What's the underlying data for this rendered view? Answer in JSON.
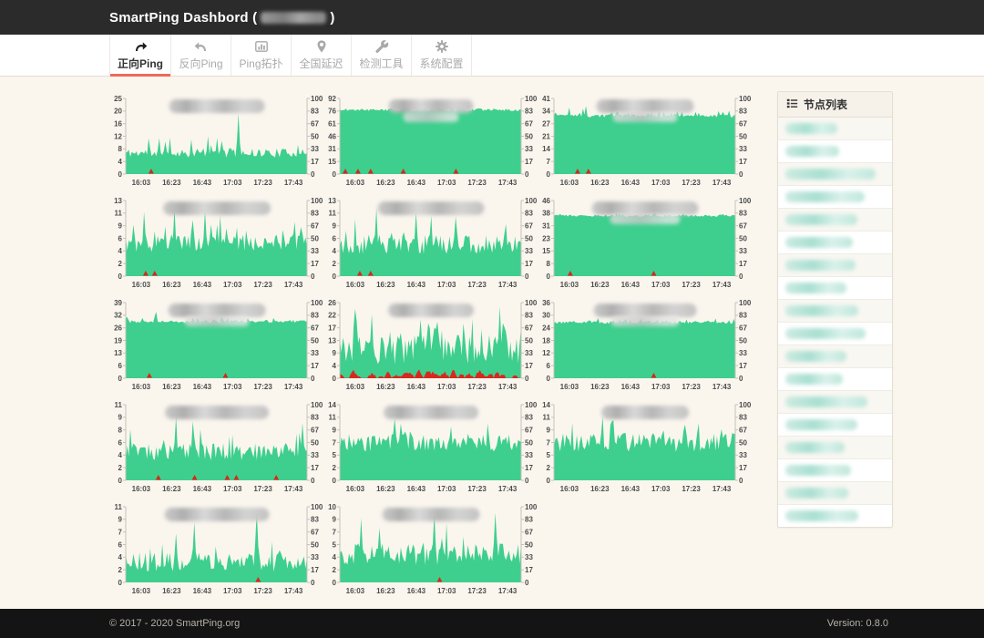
{
  "header": {
    "title_prefix": "SmartPing Dashbord (",
    "title_suffix": ")",
    "host_redacted": true
  },
  "nav": {
    "tabs": [
      {
        "label": "正向Ping",
        "icon": "forward-arrow-icon",
        "active": true
      },
      {
        "label": "反向Ping",
        "icon": "back-arrow-icon",
        "active": false
      },
      {
        "label": "Ping拓扑",
        "icon": "bar-chart-icon",
        "active": false
      },
      {
        "label": "全国延迟",
        "icon": "map-pin-icon",
        "active": false
      },
      {
        "label": "检测工具",
        "icon": "wrench-icon",
        "active": false
      },
      {
        "label": "系统配置",
        "icon": "gear-icon",
        "active": false
      }
    ]
  },
  "sidebar": {
    "title": "节点列表",
    "icon": "list-icon",
    "node_count": 18,
    "nodes_redacted": true
  },
  "footer": {
    "copyright": "© 2017 - 2020 SmartPing.org",
    "version": "Version: 0.8.0"
  },
  "colors": {
    "accent_green": "#3ecf8e",
    "loss_red": "#d7281d",
    "active_tab_underline": "#f0695a",
    "header_bg": "#2b2b2b",
    "page_bg": "#faf6ee"
  },
  "chart_data": {
    "type": "area",
    "note": "14 ping latency area charts; titles blurred in source; green=latency ms (left axis), right axis=availability %, red=packet loss",
    "x_ticks": [
      "16:03",
      "16:23",
      "16:43",
      "17:03",
      "17:23",
      "17:43"
    ],
    "right_ticks": [
      0,
      17,
      33,
      50,
      67,
      83,
      100
    ],
    "charts": [
      {
        "title_redacted": true,
        "left_ticks": [
          0,
          4,
          8,
          12,
          16,
          20,
          25
        ],
        "profile": {
          "base": 0.28,
          "noise": 0.06,
          "spike_prob": 0.08,
          "spike": 0.3,
          "peaks": [
            {
              "x": 0.62,
              "v": 0.8
            },
            {
              "x": 0.45,
              "v": 0.5
            },
            {
              "x": 0.5,
              "v": 0.48
            }
          ]
        },
        "loss_area": false,
        "loss_marks": [
          0.14
        ],
        "seed": 11
      },
      {
        "title_redacted": true,
        "left_ticks": [
          0,
          15,
          31,
          46,
          61,
          76,
          92
        ],
        "profile": {
          "base": 0.85,
          "noise": 0.018,
          "spike_prob": 0.05,
          "spike": 0.05
        },
        "loss_area": false,
        "loss_marks": [
          0.03,
          0.1,
          0.17,
          0.35,
          0.64
        ],
        "seed": 22
      },
      {
        "title_redacted": true,
        "left_ticks": [
          0,
          7,
          14,
          21,
          27,
          34,
          41
        ],
        "profile": {
          "base": 0.77,
          "noise": 0.02,
          "spike_prob": 0.18,
          "spike": 0.09,
          "peaks": [
            {
              "x": 0.08,
              "v": 0.88
            },
            {
              "x": 0.18,
              "v": 0.9
            }
          ]
        },
        "loss_area": false,
        "loss_marks": [
          0.13,
          0.19
        ],
        "seed": 33
      },
      {
        "title_redacted": true,
        "left_ticks": [
          0,
          2,
          4,
          6,
          9,
          11,
          13
        ],
        "profile": {
          "base": 0.44,
          "noise": 0.12,
          "spike_prob": 0.12,
          "spike": 0.3,
          "peaks": [
            {
              "x": 0.1,
              "v": 0.85
            },
            {
              "x": 0.27,
              "v": 0.9
            },
            {
              "x": 0.44,
              "v": 0.88
            },
            {
              "x": 0.52,
              "v": 0.8
            }
          ]
        },
        "loss_area": false,
        "loss_marks": [
          0.11,
          0.16
        ],
        "seed": 44
      },
      {
        "title_redacted": true,
        "left_ticks": [
          0,
          2,
          4,
          6,
          9,
          11,
          13
        ],
        "profile": {
          "base": 0.42,
          "noise": 0.13,
          "spike_prob": 0.12,
          "spike": 0.3,
          "peaks": [
            {
              "x": 0.2,
              "v": 0.9
            },
            {
              "x": 0.42,
              "v": 0.85
            },
            {
              "x": 0.5,
              "v": 0.8
            }
          ]
        },
        "loss_area": false,
        "loss_marks": [
          0.11,
          0.17
        ],
        "seed": 55
      },
      {
        "title_redacted": true,
        "left_ticks": [
          0,
          8,
          15,
          23,
          31,
          38,
          46
        ],
        "profile": {
          "base": 0.8,
          "noise": 0.015,
          "spike_prob": 0.08,
          "spike": 0.04
        },
        "loss_area": false,
        "loss_marks": [
          0.09,
          0.55
        ],
        "seed": 66
      },
      {
        "title_redacted": true,
        "left_ticks": [
          0,
          6,
          13,
          19,
          26,
          32,
          39
        ],
        "profile": {
          "base": 0.75,
          "noise": 0.02,
          "spike_prob": 0.15,
          "spike": 0.07,
          "peaks": [
            {
              "x": 0.17,
              "v": 0.88
            }
          ]
        },
        "loss_area": false,
        "loss_marks": [
          0.13,
          0.55
        ],
        "seed": 77
      },
      {
        "title_redacted": true,
        "left_ticks": [
          0,
          4,
          9,
          13,
          17,
          22,
          26
        ],
        "profile": {
          "base": 0.38,
          "noise": 0.2,
          "spike_prob": 0.25,
          "spike": 0.4,
          "peaks": [
            {
              "x": 0.88,
              "v": 0.95
            },
            {
              "x": 0.18,
              "v": 0.85
            }
          ]
        },
        "loss_area": true,
        "loss_marks": [],
        "seed": 88
      },
      {
        "title_redacted": true,
        "left_ticks": [
          0,
          6,
          12,
          18,
          24,
          30,
          36
        ],
        "profile": {
          "base": 0.74,
          "noise": 0.02,
          "spike_prob": 0.15,
          "spike": 0.06
        },
        "loss_area": false,
        "loss_marks": [
          0.55
        ],
        "seed": 99
      },
      {
        "title_redacted": true,
        "left_ticks": [
          0,
          2,
          4,
          6,
          8,
          9,
          11
        ],
        "profile": {
          "base": 0.38,
          "noise": 0.12,
          "spike_prob": 0.12,
          "spike": 0.3,
          "peaks": [
            {
              "x": 0.28,
              "v": 0.85
            },
            {
              "x": 0.37,
              "v": 0.78
            }
          ]
        },
        "loss_area": false,
        "loss_marks": [
          0.18,
          0.38,
          0.56,
          0.61,
          0.83
        ],
        "seed": 110
      },
      {
        "title_redacted": true,
        "left_ticks": [
          0,
          2,
          5,
          7,
          9,
          11,
          14
        ],
        "profile": {
          "base": 0.5,
          "noise": 0.12,
          "spike_prob": 0.12,
          "spike": 0.25,
          "peaks": [
            {
              "x": 0.3,
              "v": 0.82
            },
            {
              "x": 0.34,
              "v": 0.75
            }
          ]
        },
        "loss_area": false,
        "loss_marks": [],
        "seed": 121
      },
      {
        "title_redacted": true,
        "left_ticks": [
          0,
          2,
          5,
          7,
          9,
          11,
          14
        ],
        "profile": {
          "base": 0.5,
          "noise": 0.13,
          "spike_prob": 0.12,
          "spike": 0.25,
          "peaks": [
            {
              "x": 0.27,
              "v": 0.85
            },
            {
              "x": 0.32,
              "v": 0.78
            }
          ]
        },
        "loss_area": false,
        "loss_marks": [],
        "seed": 132
      },
      {
        "title_redacted": true,
        "left_ticks": [
          0,
          2,
          4,
          6,
          7,
          9,
          11
        ],
        "profile": {
          "base": 0.27,
          "noise": 0.13,
          "spike_prob": 0.1,
          "spike": 0.35,
          "peaks": [
            {
              "x": 0.38,
              "v": 0.8
            },
            {
              "x": 0.72,
              "v": 0.95
            },
            {
              "x": 0.28,
              "v": 0.65
            }
          ]
        },
        "loss_area": false,
        "loss_marks": [
          0.73
        ],
        "seed": 143
      },
      {
        "title_redacted": true,
        "left_ticks": [
          0,
          2,
          4,
          5,
          7,
          9,
          10
        ],
        "profile": {
          "base": 0.38,
          "noise": 0.15,
          "spike_prob": 0.12,
          "spike": 0.3,
          "peaks": [
            {
              "x": 0.52,
              "v": 0.92
            },
            {
              "x": 0.86,
              "v": 0.92
            },
            {
              "x": 0.12,
              "v": 0.85
            }
          ]
        },
        "loss_area": false,
        "loss_marks": [
          0.55
        ],
        "seed": 154
      }
    ]
  }
}
